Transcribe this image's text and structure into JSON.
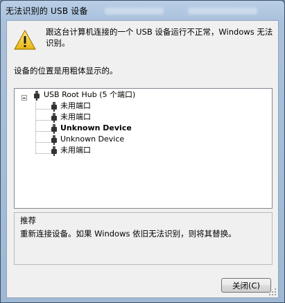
{
  "window": {
    "title": "无法识别的 USB 设备"
  },
  "dialog": {
    "message": "跟这台计算机连接的一个 USB 设备运行不正常，Windows 无法识别。",
    "location_label": "设备的位置是用粗体显示的。"
  },
  "tree": {
    "root": {
      "label": "USB Root Hub (5 个端口)",
      "icon": "usb-connector-icon"
    },
    "children": [
      {
        "label": "未用端口",
        "bold": false
      },
      {
        "label": "未用端口",
        "bold": false
      },
      {
        "label": "Unknown Device",
        "bold": true
      },
      {
        "label": "Unknown Device",
        "bold": false
      },
      {
        "label": "未用端口",
        "bold": false
      }
    ]
  },
  "recommendation": {
    "title": "推荐",
    "text": "重新连接设备。如果 Windows 依旧无法识别，则将其替换。"
  },
  "buttons": {
    "close_label": "关闭(C)"
  },
  "colors": {
    "frame": "#a9c1db",
    "client_bg": "#f0f0f0",
    "warning_yellow": "#f5d02a"
  }
}
